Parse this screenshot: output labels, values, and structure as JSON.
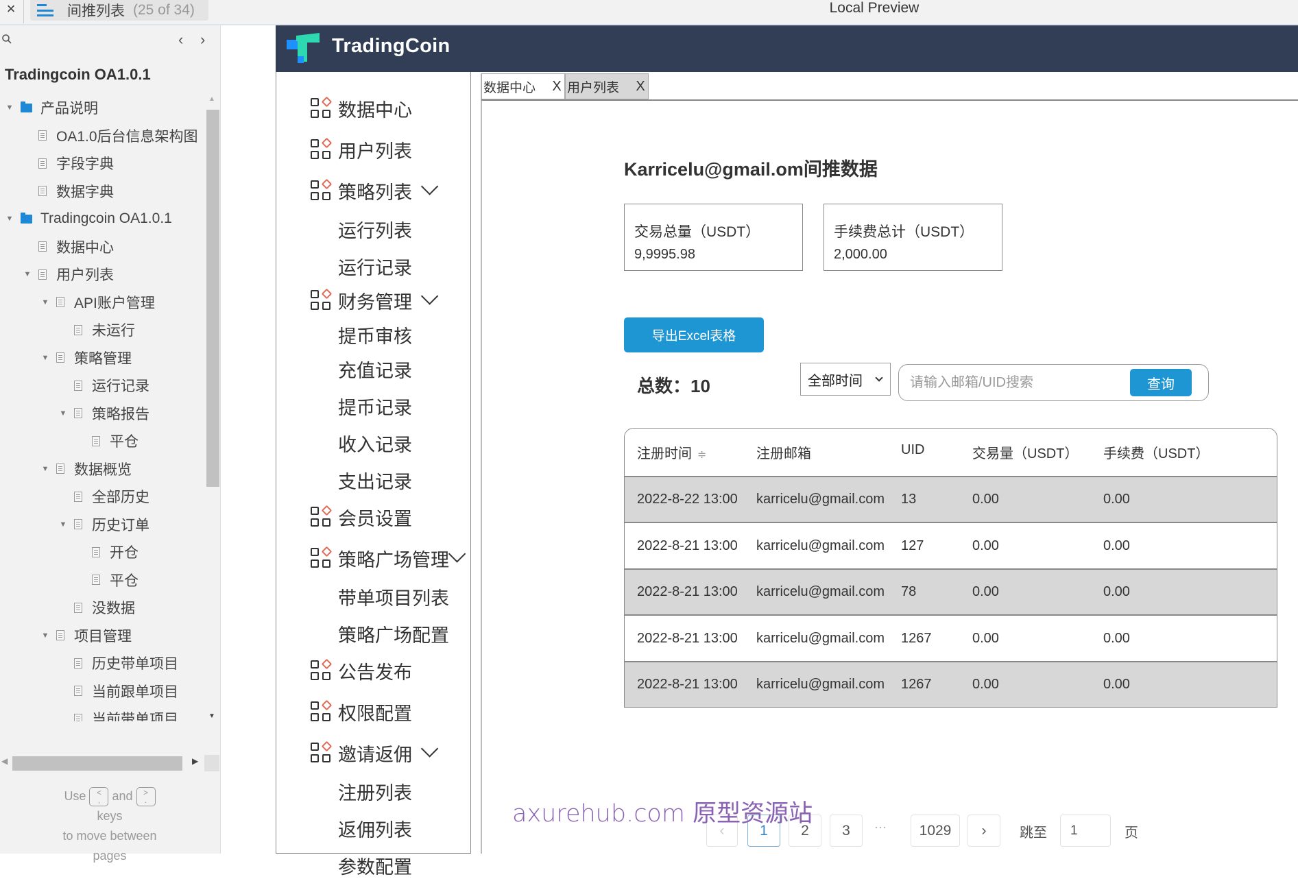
{
  "topbar": {
    "close_icon": "×",
    "page_tab_title": "间推列表",
    "page_tab_count": "(25 of 34)",
    "preview_title": "Local Preview"
  },
  "leftpanel": {
    "search_icon": "⚲",
    "prev_icon": "‹",
    "next_icon": "›",
    "project_title": "Tradingcoin OA1.0.1",
    "tree": [
      {
        "label": "产品说明",
        "type": "folder",
        "level": 0,
        "expanded": true
      },
      {
        "label": "OA1.0后台信息架构图",
        "type": "page",
        "level": 1,
        "expanded": false
      },
      {
        "label": "字段字典",
        "type": "page",
        "level": 1,
        "expanded": false
      },
      {
        "label": "数据字典",
        "type": "page",
        "level": 1,
        "expanded": false
      },
      {
        "label": "Tradingcoin OA1.0.1",
        "type": "folder",
        "level": 0,
        "expanded": true
      },
      {
        "label": "数据中心",
        "type": "page",
        "level": 1,
        "expanded": false
      },
      {
        "label": "用户列表",
        "type": "page",
        "level": 1,
        "expanded": true,
        "has_children": true
      },
      {
        "label": "API账户管理",
        "type": "page",
        "level": 2,
        "expanded": true,
        "has_children": true
      },
      {
        "label": "未运行",
        "type": "page",
        "level": 3,
        "expanded": false
      },
      {
        "label": "策略管理",
        "type": "page",
        "level": 2,
        "expanded": true,
        "has_children": true
      },
      {
        "label": "运行记录",
        "type": "page",
        "level": 3,
        "expanded": false
      },
      {
        "label": "策略报告",
        "type": "page",
        "level": 3,
        "expanded": true,
        "has_children": true
      },
      {
        "label": "平仓",
        "type": "page",
        "level": 4,
        "expanded": false
      },
      {
        "label": "数据概览",
        "type": "page",
        "level": 2,
        "expanded": true,
        "has_children": true
      },
      {
        "label": "全部历史",
        "type": "page",
        "level": 3,
        "expanded": false
      },
      {
        "label": "历史订单",
        "type": "page",
        "level": 3,
        "expanded": true,
        "has_children": true
      },
      {
        "label": "开仓",
        "type": "page",
        "level": 4,
        "expanded": false
      },
      {
        "label": "平仓",
        "type": "page",
        "level": 4,
        "expanded": false
      },
      {
        "label": "没数据",
        "type": "page",
        "level": 3,
        "expanded": false
      },
      {
        "label": "项目管理",
        "type": "page",
        "level": 2,
        "expanded": true,
        "has_children": true
      },
      {
        "label": "历史带单项目",
        "type": "page",
        "level": 3,
        "expanded": false
      },
      {
        "label": "当前跟单项目",
        "type": "page",
        "level": 3,
        "expanded": false
      },
      {
        "label": "当前带单项目",
        "type": "page",
        "level": 3,
        "expanded": false
      }
    ],
    "hint": {
      "use": "Use",
      "key_prev": "<\n,",
      "and": "and",
      "key_next": ">\n.",
      "keys": "keys",
      "line2": "to move between",
      "line3": "pages"
    }
  },
  "header": {
    "brand": "TradingCoin",
    "colors": {
      "bar": "#323e55",
      "logo_blue": "#1e90ff",
      "logo_teal": "#2ed8b0"
    }
  },
  "sidebar": {
    "items": [
      {
        "label": "数据中心",
        "icon": "grid-icon",
        "sub": false,
        "chevron": false
      },
      {
        "label": "用户列表",
        "icon": "grid-icon",
        "sub": false,
        "chevron": false
      },
      {
        "label": "策略列表",
        "icon": "grid-icon",
        "sub": false,
        "chevron": true
      },
      {
        "label": "运行列表",
        "sub": true
      },
      {
        "label": "运行记录",
        "sub": true
      },
      {
        "label": "财务管理",
        "icon": "grid-icon",
        "sub": false,
        "chevron": true
      },
      {
        "label": "提币审核",
        "sub": true
      },
      {
        "label": "充值记录",
        "sub": true
      },
      {
        "label": "提币记录",
        "sub": true
      },
      {
        "label": "收入记录",
        "sub": true
      },
      {
        "label": "支出记录",
        "sub": true
      },
      {
        "label": "会员设置",
        "icon": "grid-icon",
        "sub": false,
        "chevron": false
      },
      {
        "label": "策略广场管理",
        "icon": "grid-icon",
        "sub": false,
        "chevron": true
      },
      {
        "label": "带单项目列表",
        "sub": true
      },
      {
        "label": "策略广场配置",
        "sub": true
      },
      {
        "label": "公告发布",
        "icon": "grid-icon",
        "sub": false,
        "chevron": false
      },
      {
        "label": "权限配置",
        "icon": "grid-icon",
        "sub": false,
        "chevron": false
      },
      {
        "label": "邀请返佣",
        "icon": "grid-icon",
        "sub": false,
        "chevron": true
      },
      {
        "label": "注册列表",
        "sub": true
      },
      {
        "label": "返佣列表",
        "sub": true
      },
      {
        "label": "参数配置",
        "sub": true
      }
    ]
  },
  "tabs": [
    {
      "label": "数据中心",
      "close": "X",
      "active": true
    },
    {
      "label": "用户列表",
      "close": "X",
      "active": false
    }
  ],
  "main": {
    "title": "Karricelu@gmail.om间推数据",
    "cards": [
      {
        "label": "交易总量（USDT）",
        "value": "9,9995.98"
      },
      {
        "label": "手续费总计（USDT）",
        "value": "2,000.00"
      }
    ],
    "export_button": "导出Excel表格",
    "total_label": "总数：10",
    "time_filter": {
      "selected": "全部时间"
    },
    "search": {
      "placeholder": "请输入邮箱/UID搜索",
      "value": "",
      "button": "查询"
    },
    "accent_color": "#1e96d4",
    "table": {
      "columns": [
        "注册时间",
        "注册邮箱",
        "UID",
        "交易量（USDT）",
        "手续费（USDT）"
      ],
      "sort_icon": "≑",
      "rows": [
        [
          "2022-8-22 13:00",
          "karricelu@gmail.com",
          "13",
          "0.00",
          "0.00"
        ],
        [
          "2022-8-21 13:00",
          "karricelu@gmail.com",
          "127",
          "0.00",
          "0.00"
        ],
        [
          "2022-8-21 13:00",
          "karricelu@gmail.com",
          "78",
          "0.00",
          "0.00"
        ],
        [
          "2022-8-21 13:00",
          "karricelu@gmail.com",
          "1267",
          "0.00",
          "0.00"
        ],
        [
          "2022-8-21 13:00",
          "karricelu@gmail.com",
          "1267",
          "0.00",
          "0.00"
        ]
      ]
    },
    "pagination": {
      "prev": "‹",
      "pages": [
        "1",
        "2",
        "3"
      ],
      "current": "1",
      "ellipsis": "···",
      "last": "1029",
      "next": "›",
      "jump_label": "跳至",
      "jump_value": "1",
      "page_label": "页"
    }
  },
  "watermark": "axurehub.com 原型资源站"
}
